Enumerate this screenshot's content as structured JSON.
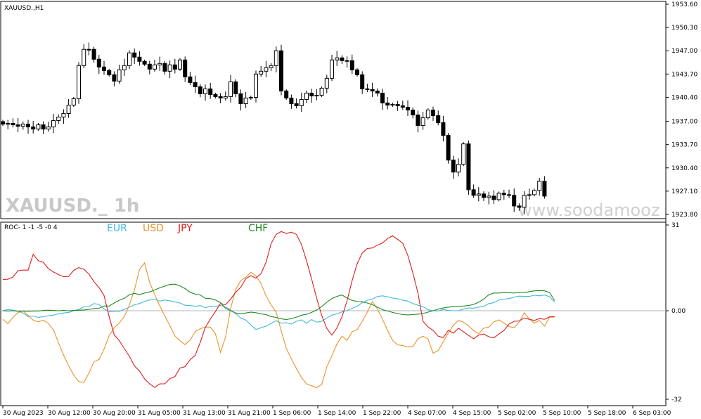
{
  "window": {
    "symbol_label": "XAUUSD.,H1",
    "watermark": "XAUUSD._ 1h",
    "site": "www.soodamooz"
  },
  "colors": {
    "EUR": "#41b8e0",
    "USD": "#e9932c",
    "JPY": "#dc1e1e",
    "CHF": "#1e8a1e",
    "zero_line": "#b4b4b4"
  },
  "chart_data": [
    {
      "type": "candlestick",
      "title": "XAUUSD.,H1",
      "yticks": [
        "1953.60",
        "1950.30",
        "1947.00",
        "1943.70",
        "1940.40",
        "1937.00",
        "1933.70",
        "1930.40",
        "1927.10",
        "1923.80"
      ],
      "ylim": [
        1923.2,
        1954.0
      ],
      "x_labels": [
        "30 Aug 2023",
        "30 Aug 12:00",
        "30 Aug 20:00",
        "31 Aug 05:00",
        "31 Aug 13:00",
        "31 Aug 21:00",
        "1 Sep 06:00",
        "1 Sep 14:00",
        "1 Sep 22:00",
        "4 Sep 07:00",
        "4 Sep 15:00",
        "5 Sep 02:00",
        "5 Sep 10:00",
        "5 Sep 18:00",
        "6 Sep 03:00"
      ],
      "close": [
        1936.6,
        1936.7,
        1936.5,
        1936.3,
        1936.6,
        1936.2,
        1935.9,
        1936.5,
        1935.9,
        1936.2,
        1937.1,
        1937.6,
        1938.1,
        1939.3,
        1940.2,
        1944.9,
        1947.2,
        1947.2,
        1945.8,
        1944.7,
        1944.2,
        1943.6,
        1942.7,
        1944.3,
        1944.9,
        1946.7,
        1946.1,
        1945.5,
        1945.1,
        1944.4,
        1945.0,
        1945.2,
        1944.1,
        1945.0,
        1944.4,
        1945.7,
        1943.3,
        1942.5,
        1941.9,
        1940.9,
        1941.6,
        1940.8,
        1940.5,
        1940.3,
        1940.5,
        1942.6,
        1940.9,
        1939.5,
        1940.3,
        1940.4,
        1943.7,
        1944.1,
        1944.6,
        1944.9,
        1947.0,
        1941.3,
        1940.3,
        1939.5,
        1939.2,
        1940.1,
        1941.0,
        1940.6,
        1940.7,
        1941.7,
        1943.1,
        1945.7,
        1946.0,
        1945.6,
        1945.6,
        1944.3,
        1943.6,
        1941.6,
        1941.5,
        1941.3,
        1941.0,
        1939.6,
        1939.3,
        1939.4,
        1939.2,
        1939.0,
        1938.6,
        1937.9,
        1936.4,
        1937.5,
        1938.6,
        1937.8,
        1936.8,
        1935.0,
        1931.5,
        1929.8,
        1930.9,
        1933.8,
        1927.3,
        1926.5,
        1926.7,
        1926.2,
        1926.4,
        1925.9,
        1926.8,
        1926.6,
        1926.5,
        1925.0,
        1924.8,
        1926.5,
        1926.6,
        1927.2,
        1928.5,
        1926.4
      ],
      "ylabel": ""
    },
    {
      "type": "line",
      "title": "ROC- 1 -1 -5 -0 4",
      "ylim": [
        -32,
        31
      ],
      "yticks": [
        "31",
        "0.00",
        "-32"
      ],
      "series": [
        {
          "name": "EUR",
          "values": [
            0.0,
            0.5,
            0.2,
            -0.1,
            -0.8,
            -2.1,
            -1.9,
            -2.4,
            -2.1,
            -1.8,
            -1.6,
            -1.1,
            -0.8,
            -0.6,
            0.0,
            0.5,
            1.4,
            1.5,
            2.6,
            2.3,
            0.6,
            -0.3,
            -0.2,
            -0.2,
            0.5,
            1.3,
            2.2,
            2.6,
            3.4,
            3.9,
            4.2,
            3.5,
            3.9,
            3.6,
            3.2,
            2.8,
            2.0,
            1.9,
            1.6,
            1.9,
            1.1,
            1.6,
            1.6,
            1.9,
            1.4,
            0.3,
            -1.0,
            -2.6,
            -3.4,
            -5.1,
            -6.8,
            -6.1,
            -5.6,
            -4.6,
            -3.6,
            -4.5,
            -4.3,
            -4.8,
            -3.8,
            -3.3,
            -4.5,
            -3.2,
            -4.1,
            -3.8,
            -2.6,
            -1.6,
            -1.1,
            -0.4,
            0.1,
            0.9,
            1.6,
            2.9,
            3.8,
            4.2,
            5.2,
            5.4,
            5.1,
            4.6,
            4.3,
            3.8,
            3.5,
            2.6,
            2.0,
            1.5,
            0.4,
            0.0,
            -0.1,
            0.5,
            0.1,
            0.0,
            0.0,
            0.6,
            1.0,
            0.9,
            1.3,
            1.6,
            2.6,
            2.9,
            3.9,
            4.2,
            4.4,
            4.9,
            5.3,
            5.2,
            5.2,
            5.6,
            5.4,
            5.7,
            5.1,
            3.1
          ]
        },
        {
          "name": "USD",
          "values": [
            -3.1,
            -4.7,
            -2.4,
            -0.7,
            0.0,
            -1.7,
            -3.4,
            -4.0,
            -3.4,
            -4.6,
            -6.9,
            -11.6,
            -16.0,
            -19.9,
            -23.2,
            -25.6,
            -25.9,
            -22.6,
            -18.4,
            -17.6,
            -13.9,
            -9.0,
            -6.2,
            -4.4,
            -2.1,
            2.1,
            7.5,
            14.9,
            17.3,
            10.3,
            5.8,
            1.8,
            -1.9,
            -5.4,
            -9.1,
            -10.8,
            -12.2,
            -10.6,
            -7.5,
            -6.5,
            -5.9,
            -5.9,
            -8.3,
            -15.0,
            -9.5,
            0.8,
            7.7,
            10.9,
            12.1,
            13.9,
            12.6,
            9.9,
            5.4,
            2.1,
            -0.5,
            -7.3,
            -13.6,
            -17.4,
            -20.9,
            -24.1,
            -26.4,
            -27.1,
            -27.8,
            -26.6,
            -20.3,
            -16.3,
            -12.0,
            -9.2,
            -10.7,
            -7.6,
            -6.8,
            -3.8,
            -0.5,
            3.3,
            0.6,
            -3.0,
            -7.1,
            -10.7,
            -12.3,
            -12.6,
            -13.1,
            -12.9,
            -10.1,
            -9.2,
            -10.2,
            -15.3,
            -14.4,
            -11.2,
            -8.1,
            -5.2,
            -3.5,
            -4.1,
            -5.4,
            -7.2,
            -8.3,
            -6.3,
            -5.9,
            -4.0,
            -3.3,
            -4.5,
            -5.7,
            -6.1,
            -4.1,
            -0.7,
            -3.0,
            -4.5,
            -3.5,
            -5.6,
            -2.3,
            -2.3
          ]
        },
        {
          "name": "JPY",
          "values": [
            11.3,
            11.4,
            12.2,
            14.5,
            14.7,
            14.7,
            20.4,
            18.1,
            17.5,
            15.2,
            14.0,
            13.1,
            12.3,
            12.4,
            14.6,
            15.6,
            15.0,
            13.3,
            10.5,
            8.4,
            5.5,
            -2.1,
            -8.7,
            -10.8,
            -13.7,
            -16.4,
            -19.9,
            -21.8,
            -24.6,
            -26.4,
            -27.7,
            -26.4,
            -26.4,
            -24.5,
            -23.8,
            -20.7,
            -20.2,
            -17.7,
            -16.1,
            -11.4,
            -6.0,
            -3.0,
            -0.3,
            2.6,
            2.2,
            4.2,
            6.7,
            8.5,
            11.6,
            12.7,
            11.8,
            13.4,
            17.5,
            24.3,
            27.6,
            28.6,
            27.9,
            28.4,
            27.6,
            23.9,
            18.1,
            11.5,
            4.5,
            -1.7,
            -6.4,
            -8.8,
            -6.2,
            -2.2,
            3.6,
            10.9,
            17.0,
            20.9,
            22.5,
            22.7,
            23.7,
            24.5,
            26.1,
            27.1,
            25.8,
            24.4,
            20.0,
            13.7,
            6.4,
            -3.8,
            -5.8,
            -7.1,
            -9.2,
            -9.7,
            -7.1,
            -8.1,
            -6.3,
            -7.6,
            -8.9,
            -10.1,
            -8.8,
            -8.4,
            -9.4,
            -9.8,
            -8.4,
            -7.1,
            -4.8,
            -3.8,
            -3.7,
            -2.6,
            -3.1,
            -3.5,
            -2.8,
            -3.1,
            -2.2,
            -2.1
          ]
        },
        {
          "name": "CHF",
          "values": [
            0.0,
            -0.1,
            0.0,
            -0.2,
            -0.1,
            -0.2,
            -0.1,
            -0.1,
            0.1,
            0.2,
            0.1,
            0.0,
            0.1,
            0.0,
            0.1,
            0.2,
            0.3,
            0.5,
            0.8,
            0.9,
            1.7,
            1.7,
            2.8,
            3.8,
            4.5,
            5.8,
            6.3,
            5.8,
            6.4,
            6.8,
            7.5,
            8.3,
            8.9,
            9.5,
            9.6,
            9.0,
            8.0,
            6.7,
            6.0,
            5.7,
            4.5,
            4.4,
            3.9,
            2.9,
            0.9,
            0.0,
            -0.8,
            -1.1,
            -0.8,
            -0.5,
            -0.7,
            -1.1,
            -1.4,
            -2.1,
            -2.4,
            -2.9,
            -3.2,
            -2.8,
            -2.3,
            -1.6,
            -1.3,
            -0.6,
            0.3,
            1.5,
            3.1,
            4.4,
            5.2,
            5.7,
            4.6,
            3.7,
            3.4,
            3.2,
            2.8,
            2.2,
            1.3,
            0.4,
            -0.1,
            -0.6,
            -1.0,
            -1.4,
            -1.5,
            -1.4,
            -1.2,
            -1.0,
            -0.5,
            0.0,
            0.6,
            1.0,
            1.3,
            1.5,
            1.6,
            1.7,
            1.9,
            2.3,
            3.1,
            4.2,
            5.8,
            6.4,
            6.4,
            6.6,
            6.5,
            6.4,
            6.7,
            6.6,
            6.9,
            7.2,
            7.3,
            7.2,
            6.6,
            3.7
          ]
        }
      ],
      "ylabel": ""
    }
  ]
}
